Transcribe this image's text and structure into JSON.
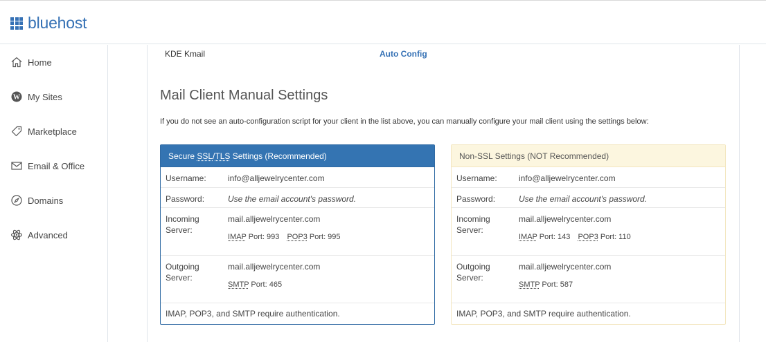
{
  "brand": {
    "name": "bluehost",
    "color": "#3571b5"
  },
  "sidebar": {
    "items": [
      {
        "label": "Home",
        "icon": "home-icon"
      },
      {
        "label": "My Sites",
        "icon": "wordpress-icon"
      },
      {
        "label": "Marketplace",
        "icon": "tag-icon"
      },
      {
        "label": "Email & Office",
        "icon": "envelope-icon"
      },
      {
        "label": "Domains",
        "icon": "compass-icon"
      },
      {
        "label": "Advanced",
        "icon": "atom-icon"
      }
    ]
  },
  "client_row": {
    "name": "KDE Kmail",
    "action": "Auto Config"
  },
  "manual": {
    "title": "Mail Client Manual Settings",
    "description": "If you do not see an auto-configuration script for your client in the list above, you can manually configure your mail client using the settings below:"
  },
  "secure": {
    "title_prefix": "Secure ",
    "title_ssl": "SSL",
    "title_slash": "/",
    "title_tls": "TLS",
    "title_suffix": " Settings (Recommended)",
    "username_label": "Username:",
    "username": "info@alljewelrycenter.com",
    "password_label": "Password:",
    "password": "Use the email account's password.",
    "incoming_label_1": "Incoming",
    "incoming_label_2": "Server:",
    "incoming_server": "mail.alljewelrycenter.com",
    "imap": "IMAP",
    "imap_port": "Port: 993",
    "pop3": "POP3",
    "pop3_port": "Port: 995",
    "outgoing_label_1": "Outgoing",
    "outgoing_label_2": "Server:",
    "outgoing_server": "mail.alljewelrycenter.com",
    "smtp": "SMTP",
    "smtp_port": "Port: 465",
    "note": "IMAP, POP3, and SMTP require authentication."
  },
  "nonssl": {
    "title": "Non-SSL Settings (NOT Recommended)",
    "username_label": "Username:",
    "username": "info@alljewelrycenter.com",
    "password_label": "Password:",
    "password": "Use the email account's password.",
    "incoming_label_1": "Incoming",
    "incoming_label_2": "Server:",
    "incoming_server": "mail.alljewelrycenter.com",
    "imap": "IMAP",
    "imap_port": "Port: 143",
    "pop3": "POP3",
    "pop3_port": "Port: 110",
    "outgoing_label_1": "Outgoing",
    "outgoing_label_2": "Server:",
    "outgoing_server": "mail.alljewelrycenter.com",
    "smtp": "SMTP",
    "smtp_port": "Port: 587",
    "note": "IMAP, POP3, and SMTP require authentication."
  },
  "colors": {
    "secure_header": "#3474b2",
    "nonssl_header": "#fcf6df",
    "link": "#3571b5"
  }
}
